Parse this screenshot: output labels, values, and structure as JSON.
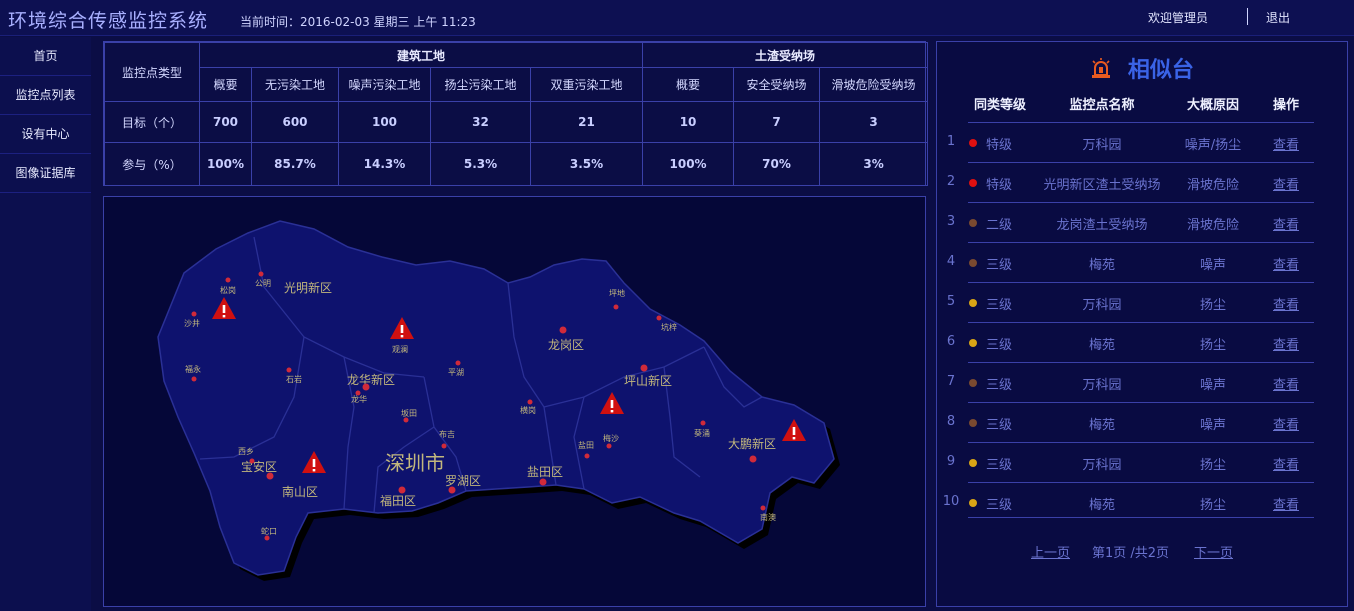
{
  "header": {
    "title": "环境综合传感监控系统",
    "time_text": "当前时间：2016-02-03 星期三 上午 11:23",
    "welcome": "欢迎管理员",
    "logout": "退出"
  },
  "sidebar": {
    "items": [
      {
        "label": "首页"
      },
      {
        "label": "监控点列表"
      },
      {
        "label": "设有中心"
      },
      {
        "label": "图像证据库"
      }
    ]
  },
  "stats": {
    "row_header": "监控点类型",
    "group1": "建筑工地",
    "group2": "土渣受纳场",
    "columns": [
      "概要",
      "无污染工地",
      "噪声污染工地",
      "扬尘污染工地",
      "双重污染工地",
      "概要",
      "安全受纳场",
      "滑坡危险受纳场"
    ],
    "target_label": "目标（个）",
    "target_values": [
      "700",
      "600",
      "100",
      "32",
      "21",
      "10",
      "7",
      "3"
    ],
    "participate_label": "参与（%）",
    "participate_values": [
      "100%",
      "85.7%",
      "14.3%",
      "5.3%",
      "3.5%",
      "100%",
      "70%",
      "3%"
    ]
  },
  "map": {
    "city": "深圳市",
    "districts": [
      "光明新区",
      "龙岗区",
      "坪山新区",
      "龙华新区",
      "宝安区",
      "南山区",
      "福田区",
      "罗湖区",
      "盐田区",
      "大鹏新区"
    ],
    "towns": [
      "公明",
      "松岗",
      "沙井",
      "观澜",
      "坪地",
      "坑梓",
      "平湖",
      "福永",
      "石岩",
      "龙华",
      "坂田",
      "横岗",
      "西乡",
      "布吉",
      "盐田",
      "梅沙",
      "葵涌",
      "南澳",
      "蛇口"
    ],
    "colors": {
      "land": "#0e126e",
      "land_edge": "#2a3096",
      "shadow": "#000000",
      "pin": "#d02a3a",
      "alarm": "#d01010"
    }
  },
  "ranking": {
    "title": "相似台",
    "headers": {
      "level": "同类等级",
      "name": "监控点名称",
      "reason": "大概原因",
      "op": "操作"
    },
    "rows": [
      {
        "num": "1",
        "level": "特级",
        "name": "万科园",
        "reason": "噪声/扬尘",
        "op": "查看",
        "dot": "#e01010"
      },
      {
        "num": "2",
        "level": "特级",
        "name": "光明新区渣土受纳场",
        "reason": "滑坡危险",
        "op": "查看",
        "dot": "#e01010"
      },
      {
        "num": "3",
        "level": "二级",
        "name": "龙岗渣土受纳场",
        "reason": "滑坡危险",
        "op": "查看",
        "dot": "#7a4a30"
      },
      {
        "num": "4",
        "level": "三级",
        "name": "梅苑",
        "reason": "噪声",
        "op": "查看",
        "dot": "#7a4a30"
      },
      {
        "num": "5",
        "level": "三级",
        "name": "万科园",
        "reason": "扬尘",
        "op": "查看",
        "dot": "#d9a515"
      },
      {
        "num": "6",
        "level": "三级",
        "name": "梅苑",
        "reason": "扬尘",
        "op": "查看",
        "dot": "#d9a515"
      },
      {
        "num": "7",
        "level": "三级",
        "name": "万科园",
        "reason": "噪声",
        "op": "查看",
        "dot": "#7a4a30"
      },
      {
        "num": "8",
        "level": "三级",
        "name": "梅苑",
        "reason": "噪声",
        "op": "查看",
        "dot": "#7a4a30"
      },
      {
        "num": "9",
        "level": "三级",
        "name": "万科园",
        "reason": "扬尘",
        "op": "查看",
        "dot": "#d9a515"
      },
      {
        "num": "10",
        "level": "三级",
        "name": "梅苑",
        "reason": "扬尘",
        "op": "查看",
        "dot": "#d9a515"
      }
    ],
    "pager": {
      "prev": "上一页",
      "info": "第1页 /共2页",
      "next": "下一页"
    }
  }
}
